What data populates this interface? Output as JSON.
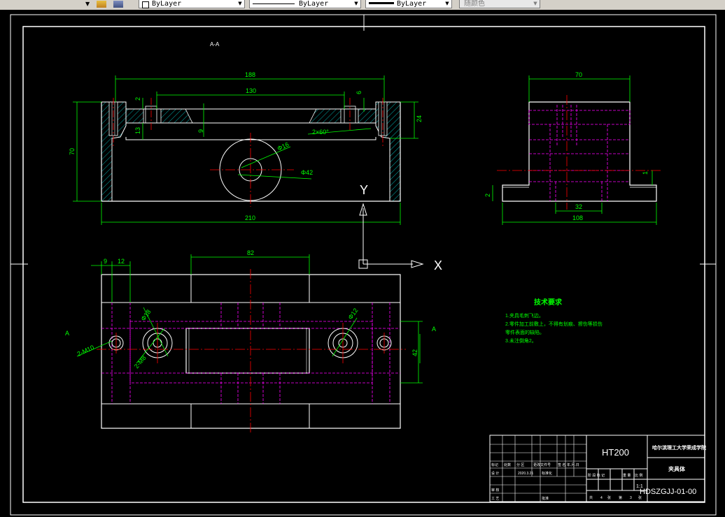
{
  "toolbar": {
    "layer_combo": "ByLayer",
    "linetype_combo": "ByLayer",
    "lineweight_combo": "ByLayer",
    "color_combo": "随颜色"
  },
  "drawing": {
    "section_label": "A-A",
    "ucs_x": "X",
    "ucs_y": "Y",
    "section_view": {
      "dim_188": "188",
      "dim_130": "130",
      "dim_70": "70",
      "dim_24": "24",
      "dim_210": "210",
      "dim_2": "2",
      "dim_13": "13",
      "dim_9": "9",
      "dim_6": "6",
      "dim_phi16": "Φ16",
      "dim_phi42": "Φ42",
      "dim_chamfer": "2×60°"
    },
    "side_view": {
      "dim_70": "70",
      "dim_32": "32",
      "dim_108": "108",
      "dim_1": "1",
      "dim_2": "2"
    },
    "top_view": {
      "dim_82": "82",
      "dim_9": "9",
      "dim_12": "12",
      "dim_42": "42",
      "dim_m10": "2-M10",
      "dim_m8": "2-M8",
      "dim_phi18": "Φ18",
      "dim_phi12": "Φ12",
      "marker_a_left": "A",
      "marker_a_right": "A"
    },
    "tech_req": {
      "title": "技术要求",
      "items": [
        "1.夹具毛刺飞边。",
        "2.零件加工前敷上，不得有划痕、擦伤等损伤",
        "零件表面的缺陷。",
        "3.未注倒角2。"
      ]
    },
    "title_block": {
      "material": "HT200",
      "school": "哈尔滨理工大学荣成学院",
      "part_name": "夹具体",
      "drawing_no": "HDSZGJJ-01-00",
      "scale": "1:1",
      "sheet_total": "4",
      "sheet_num": "3",
      "header_row": [
        "标记",
        "处数",
        "分  区",
        "更改文件号",
        "签  名",
        "年.月.日"
      ],
      "design": "设  计",
      "review": "审  核",
      "process": "工  艺",
      "approve": "批准",
      "stage_label": "阶 段 标 记",
      "weight": "重 量",
      "ratio": "比 例",
      "std": "标准化",
      "designer_date": "2020.3.21",
      "total_label": "共",
      "sheet_label": "张",
      "page_label": "第",
      "page_unit": "张"
    }
  }
}
